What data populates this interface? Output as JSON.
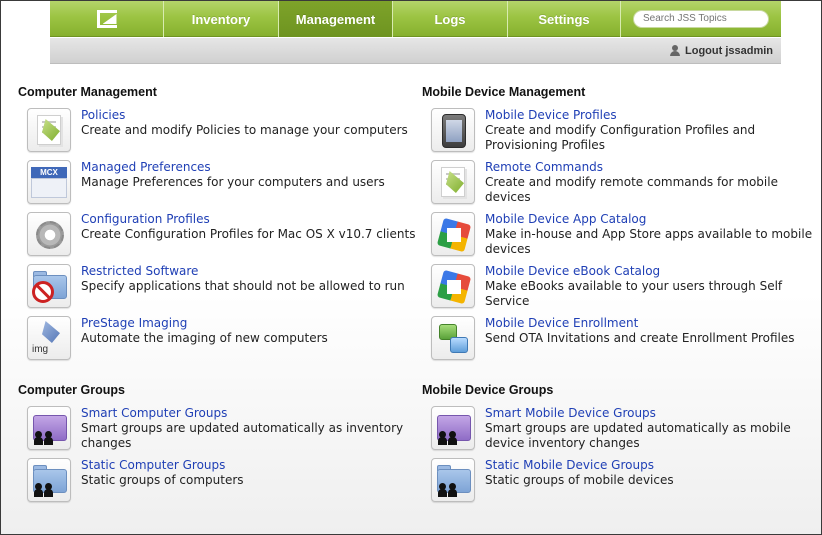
{
  "nav": {
    "tabs": [
      {
        "label": "Inventory"
      },
      {
        "label": "Management"
      },
      {
        "label": "Logs"
      },
      {
        "label": "Settings"
      }
    ],
    "search_placeholder": "Search JSS Topics",
    "active_tab": "Management"
  },
  "subbar": {
    "logout_label": "Logout jssadmin"
  },
  "sections": {
    "computer_management": {
      "title": "Computer Management",
      "items": [
        {
          "icon": "policies-icon",
          "link": "Policies",
          "desc": "Create and modify Policies to manage your computers"
        },
        {
          "icon": "mcx-icon",
          "link": "Managed Preferences",
          "desc": "Manage Preferences for your computers and users"
        },
        {
          "icon": "gear-icon",
          "link": "Configuration Profiles",
          "desc": "Create Configuration Profiles for Mac OS X v10.7 clients"
        },
        {
          "icon": "restricted-software-icon",
          "link": "Restricted Software",
          "desc": "Specify applications that should not be allowed to run"
        },
        {
          "icon": "prestage-imaging-icon",
          "link": "PreStage Imaging",
          "desc": "Automate the imaging of new computers"
        }
      ]
    },
    "mobile_device_management": {
      "title": "Mobile Device Management",
      "items": [
        {
          "icon": "mobile-profiles-icon",
          "link": "Mobile Device Profiles",
          "desc": "Create and modify Configuration Profiles and Provisioning Profiles"
        },
        {
          "icon": "remote-commands-icon",
          "link": "Remote Commands",
          "desc": "Create and modify remote commands for mobile devices"
        },
        {
          "icon": "app-catalog-icon",
          "link": "Mobile Device App Catalog",
          "desc": "Make in-house and App Store apps available to mobile devices"
        },
        {
          "icon": "ebook-catalog-icon",
          "link": "Mobile Device eBook Catalog",
          "desc": "Make eBooks available to your users through Self Service"
        },
        {
          "icon": "enrollment-icon",
          "link": "Mobile Device Enrollment",
          "desc": "Send OTA Invitations and create Enrollment Profiles"
        }
      ]
    },
    "computer_groups": {
      "title": "Computer Groups",
      "items": [
        {
          "icon": "smart-group-icon",
          "link": "Smart Computer Groups",
          "desc": "Smart groups are updated automatically as inventory changes"
        },
        {
          "icon": "static-group-icon",
          "link": "Static Computer Groups",
          "desc": "Static groups of computers"
        }
      ]
    },
    "mobile_device_groups": {
      "title": "Mobile Device Groups",
      "items": [
        {
          "icon": "smart-group-icon",
          "link": "Smart Mobile Device Groups",
          "desc": "Smart groups are updated automatically as mobile device inventory changes"
        },
        {
          "icon": "static-group-icon",
          "link": "Static Mobile Device Groups",
          "desc": "Static groups of mobile devices"
        }
      ]
    }
  },
  "icon_labels": {
    "mcx": "MCX",
    "img": "img"
  },
  "colors": {
    "nav_green": "#9cc443",
    "active_tab": "#7ea32a",
    "link_blue": "#1f3fb5"
  }
}
